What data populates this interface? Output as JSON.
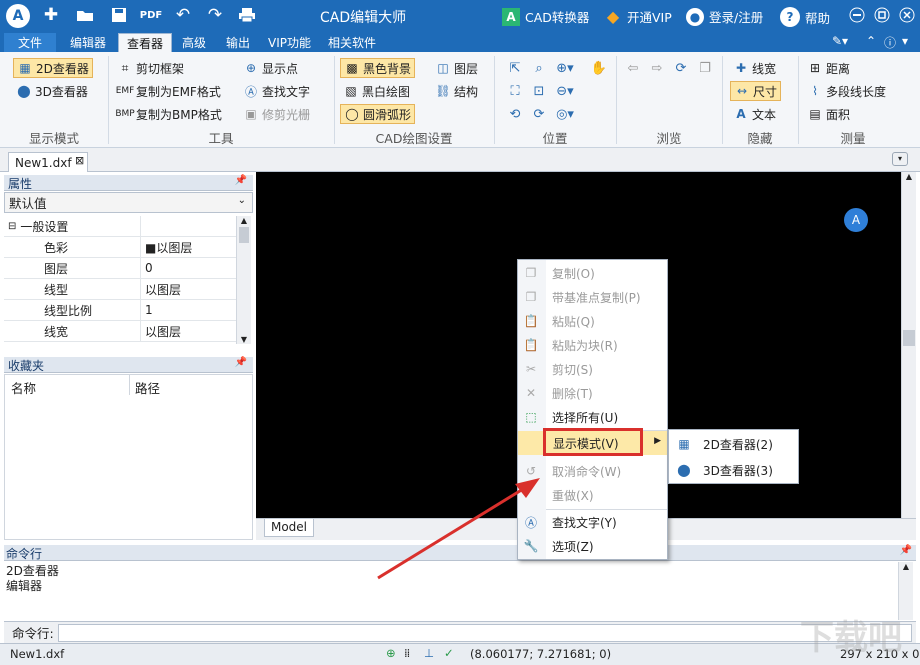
{
  "app": {
    "title": "CAD编辑大师"
  },
  "topbar": {
    "converter_label": "CAD转换器",
    "vip_label": "开通VIP",
    "login_label": "登录/注册",
    "help_label": "帮助"
  },
  "menu_tabs": [
    {
      "label": "文件"
    },
    {
      "label": "编辑器"
    },
    {
      "label": "查看器"
    },
    {
      "label": "高级"
    },
    {
      "label": "输出"
    },
    {
      "label": "VIP功能"
    },
    {
      "label": "相关软件"
    }
  ],
  "ribbon": {
    "display_mode": {
      "label": "显示模式",
      "viewer2d": "2D查看器",
      "viewer3d": "3D查看器"
    },
    "tools": {
      "label": "工具",
      "clip_frame": "剪切框架",
      "copy_emf": "复制为EMF格式",
      "copy_bmp": "复制为BMP格式",
      "show_points": "显示点",
      "find_text": "查找文字",
      "trim_raster": "修剪光栅"
    },
    "cad_settings": {
      "label": "CAD绘图设置",
      "black_bg": "黑色背景",
      "bw_draw": "黑白绘图",
      "smooth_arc": "圆滑弧形",
      "layers": "图层",
      "structure": "结构"
    },
    "position": {
      "label": "位置"
    },
    "browse": {
      "label": "浏览"
    },
    "hide": {
      "label": "隐藏",
      "line_width": "线宽",
      "dimension": "尺寸",
      "text": "文本"
    },
    "measure": {
      "label": "测量",
      "distance": "距离",
      "polyline_length": "多段线长度",
      "area": "面积"
    }
  },
  "document": {
    "tab_name": "New1.dxf"
  },
  "properties": {
    "title": "属性",
    "selector": "默认值",
    "group": "一般设置",
    "rows": [
      {
        "key": "色彩",
        "value": "■以图层"
      },
      {
        "key": "图层",
        "value": "0"
      },
      {
        "key": "线型",
        "value": "以图层"
      },
      {
        "key": "线型比例",
        "value": "1"
      },
      {
        "key": "线宽",
        "value": "以图层"
      }
    ]
  },
  "favorites": {
    "title": "收藏夹",
    "col_name": "名称",
    "col_path": "路径"
  },
  "canvas": {
    "model_tab": "Model"
  },
  "context_menu": {
    "items": [
      {
        "label": "复制(O)",
        "enabled": false
      },
      {
        "label": "带基准点复制(P)",
        "enabled": false
      },
      {
        "label": "粘贴(Q)",
        "enabled": false
      },
      {
        "label": "粘贴为块(R)",
        "enabled": false
      },
      {
        "label": "剪切(S)",
        "enabled": false
      },
      {
        "label": "删除(T)",
        "enabled": false
      },
      {
        "label": "选择所有(U)",
        "enabled": true
      },
      {
        "label": "显示模式(V)",
        "enabled": true
      },
      {
        "label": "取消命令(W)",
        "enabled": false
      },
      {
        "label": "重做(X)",
        "enabled": false
      },
      {
        "label": "查找文字(Y)",
        "enabled": true
      },
      {
        "label": "选项(Z)",
        "enabled": true
      }
    ],
    "submenu": [
      {
        "label": "2D查看器(2)"
      },
      {
        "label": "3D查看器(3)"
      }
    ]
  },
  "command": {
    "title": "命令行",
    "history": [
      "2D查看器",
      "编辑器"
    ],
    "prompt": "命令行:"
  },
  "status": {
    "file": "New1.dxf",
    "coords": "(8.060177; 7.271681; 0)",
    "paper_size": "297 x 210 x 0"
  },
  "colors": {
    "titlebar": "#1e6bb8",
    "highlight_box": "#d9302c",
    "arrow": "#d9302c"
  }
}
